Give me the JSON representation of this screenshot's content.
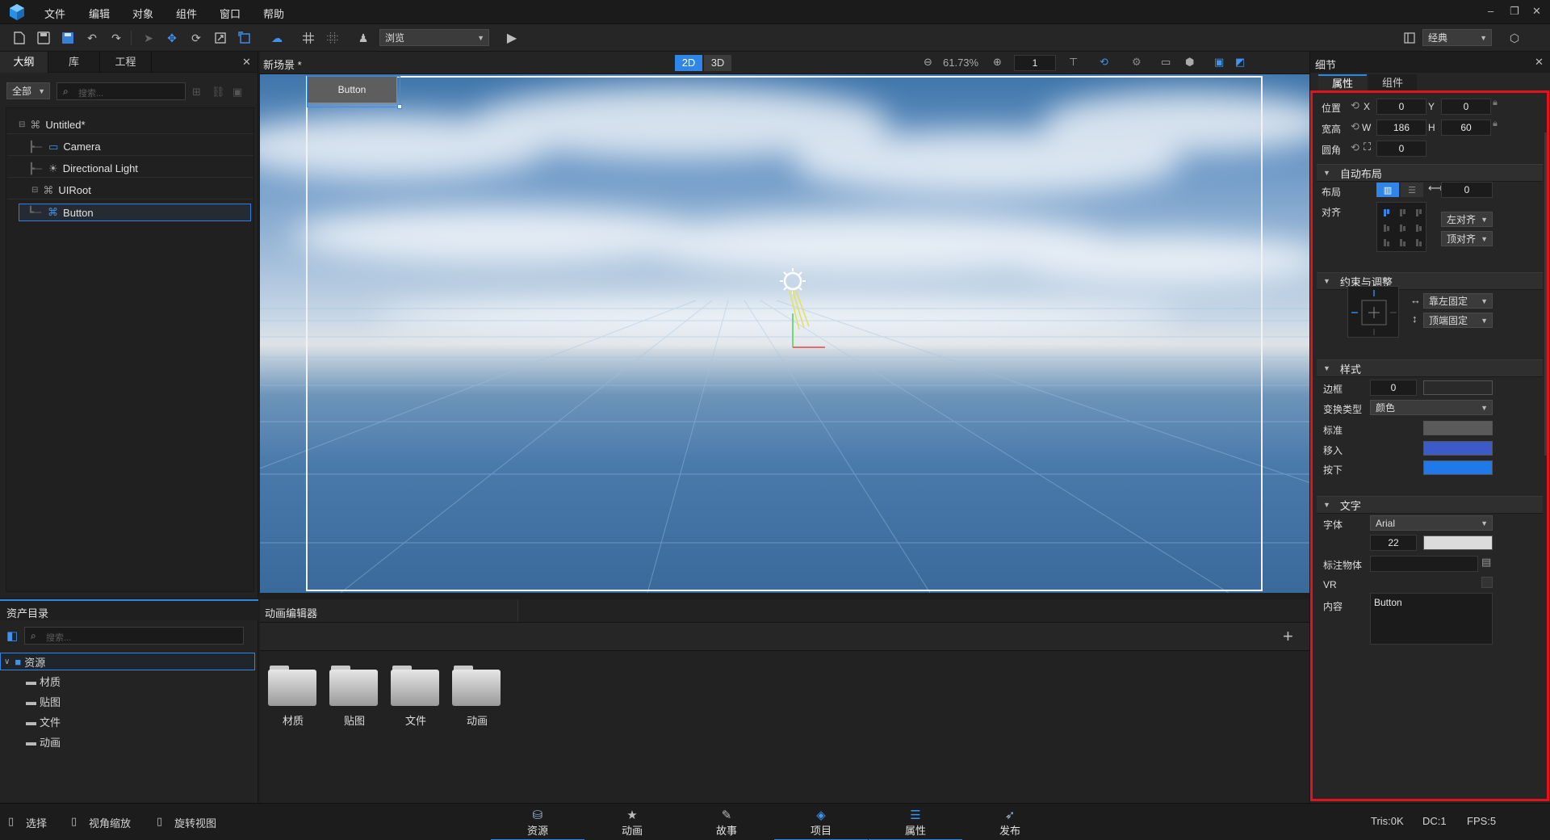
{
  "menubar": {
    "items": [
      "文件",
      "编辑",
      "对象",
      "组件",
      "窗口",
      "帮助"
    ],
    "window_controls": [
      "–",
      "❐",
      "✕"
    ]
  },
  "toolbar": {
    "view_mode": "浏览",
    "layout_mode": "经典"
  },
  "outline": {
    "tabs": [
      "大纲",
      "库",
      "工程"
    ],
    "filter": "全部",
    "search_placeholder": "搜索...",
    "tree": [
      {
        "label": "Untitled*"
      },
      {
        "label": "Camera"
      },
      {
        "label": "Directional Light"
      },
      {
        "label": "UIRoot"
      },
      {
        "label": "Button"
      }
    ]
  },
  "viewport": {
    "tab_title": "新场景 *",
    "mode_2d": "2D",
    "mode_3d": "3D",
    "zoom": "61.73%",
    "page_value": "1",
    "button_label": "Button"
  },
  "assets": {
    "title": "资产目录",
    "search_placeholder": "搜索...",
    "root": "资源",
    "children": [
      "材质",
      "贴图",
      "文件",
      "动画"
    ]
  },
  "anim_editor": {
    "title": "动画编辑器",
    "folders": [
      "材质",
      "贴图",
      "文件",
      "动画"
    ]
  },
  "details": {
    "title": "细节",
    "tabs": [
      "属性",
      "组件"
    ],
    "position": {
      "label": "位置",
      "x_label": "X",
      "x": "0",
      "y_label": "Y",
      "y": "0"
    },
    "size": {
      "label": "宽高",
      "w_label": "W",
      "w": "186",
      "h_label": "H",
      "h": "60"
    },
    "radius": {
      "label": "圆角",
      "value": "0"
    },
    "auto_layout": {
      "title": "自动布局",
      "layout_label": "布局",
      "spacing": "0",
      "align_label": "对齐",
      "h_align": "左对齐",
      "v_align": "顶对齐"
    },
    "constraint": {
      "title": "约束与调整",
      "h": "靠左固定",
      "v": "顶端固定"
    },
    "style": {
      "title": "样式",
      "border_label": "边框",
      "border": "0",
      "transition_label": "变换类型",
      "transition": "颜色",
      "normal_label": "标准",
      "hover_label": "移入",
      "pressed_label": "按下"
    },
    "text": {
      "title": "文字",
      "font_label": "字体",
      "font": "Arial",
      "size": "22",
      "target_label": "标注物体",
      "vr_label": "VR",
      "content_label": "内容",
      "content": "Button"
    }
  },
  "status": {
    "hints": [
      "选择",
      "视角缩放",
      "旋转视图"
    ],
    "tabs": [
      "资源",
      "动画",
      "故事",
      "项目",
      "属性",
      "发布"
    ],
    "tris": "Tris:0K",
    "dc": "DC:1",
    "fps": "FPS:5"
  },
  "colors": {
    "accent": "#2f86e8",
    "hover_swatch": "#3c5bc9",
    "pressed_swatch": "#1f79ea",
    "normal_swatch": "#5a5a5a",
    "highlight_border": "#e1141d"
  }
}
